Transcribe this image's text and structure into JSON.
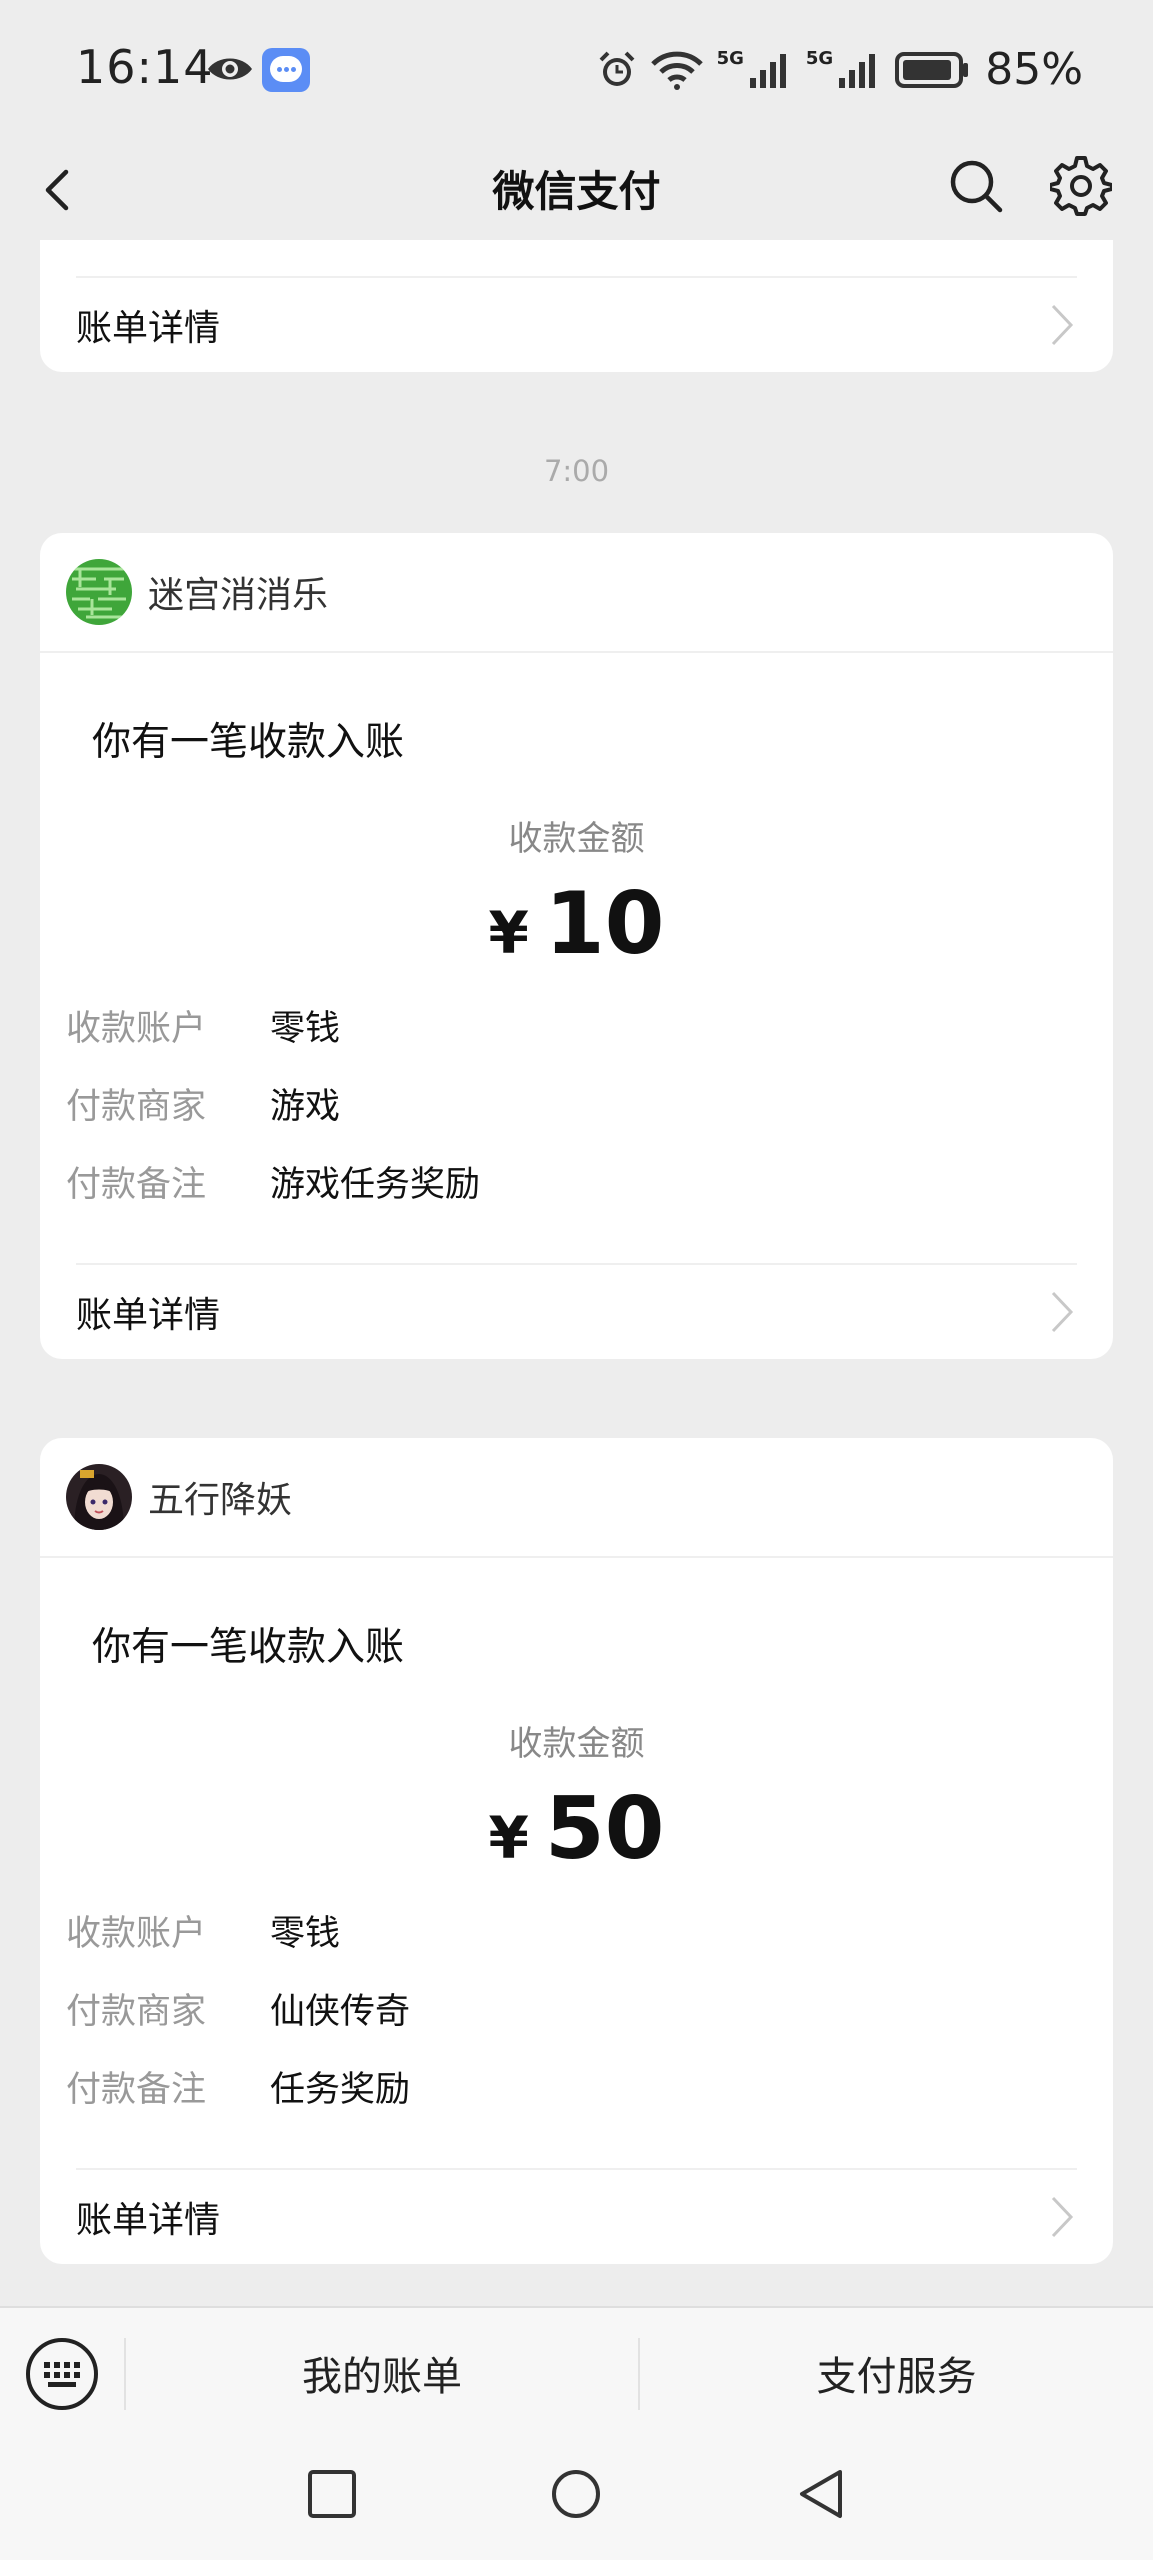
{
  "status_bar": {
    "time": "16:14",
    "network_1": "5G",
    "network_2": "5G",
    "battery": "85%"
  },
  "nav": {
    "title": "微信支付",
    "back_icon": "chevron-left-icon",
    "search_icon": "search-icon",
    "settings_icon": "gear-icon"
  },
  "cards": [
    {
      "detail_label": "账单详情"
    },
    {
      "time": "7:00",
      "merchant": "迷宫消消乐",
      "notice": "你有一笔收款入账",
      "amount_label": "收款金额",
      "currency": "¥",
      "amount": "10",
      "rows": [
        {
          "key": "收款账户",
          "value": "零钱"
        },
        {
          "key": "付款商家",
          "value": "游戏"
        },
        {
          "key": "付款备注",
          "value": "游戏任务奖励"
        }
      ],
      "detail_label": "账单详情"
    },
    {
      "merchant": "五行降妖",
      "notice": "你有一笔收款入账",
      "amount_label": "收款金额",
      "currency": "¥",
      "amount": "50",
      "rows": [
        {
          "key": "收款账户",
          "value": "零钱"
        },
        {
          "key": "付款商家",
          "value": "仙侠传奇"
        },
        {
          "key": "付款备注",
          "value": "任务奖励"
        }
      ],
      "detail_label": "账单详情"
    }
  ],
  "bottom_bar": {
    "my_bills": "我的账单",
    "pay_services": "支付服务"
  },
  "colors": {
    "background": "#ededed",
    "card": "#ffffff",
    "muted_text": "#999999"
  }
}
